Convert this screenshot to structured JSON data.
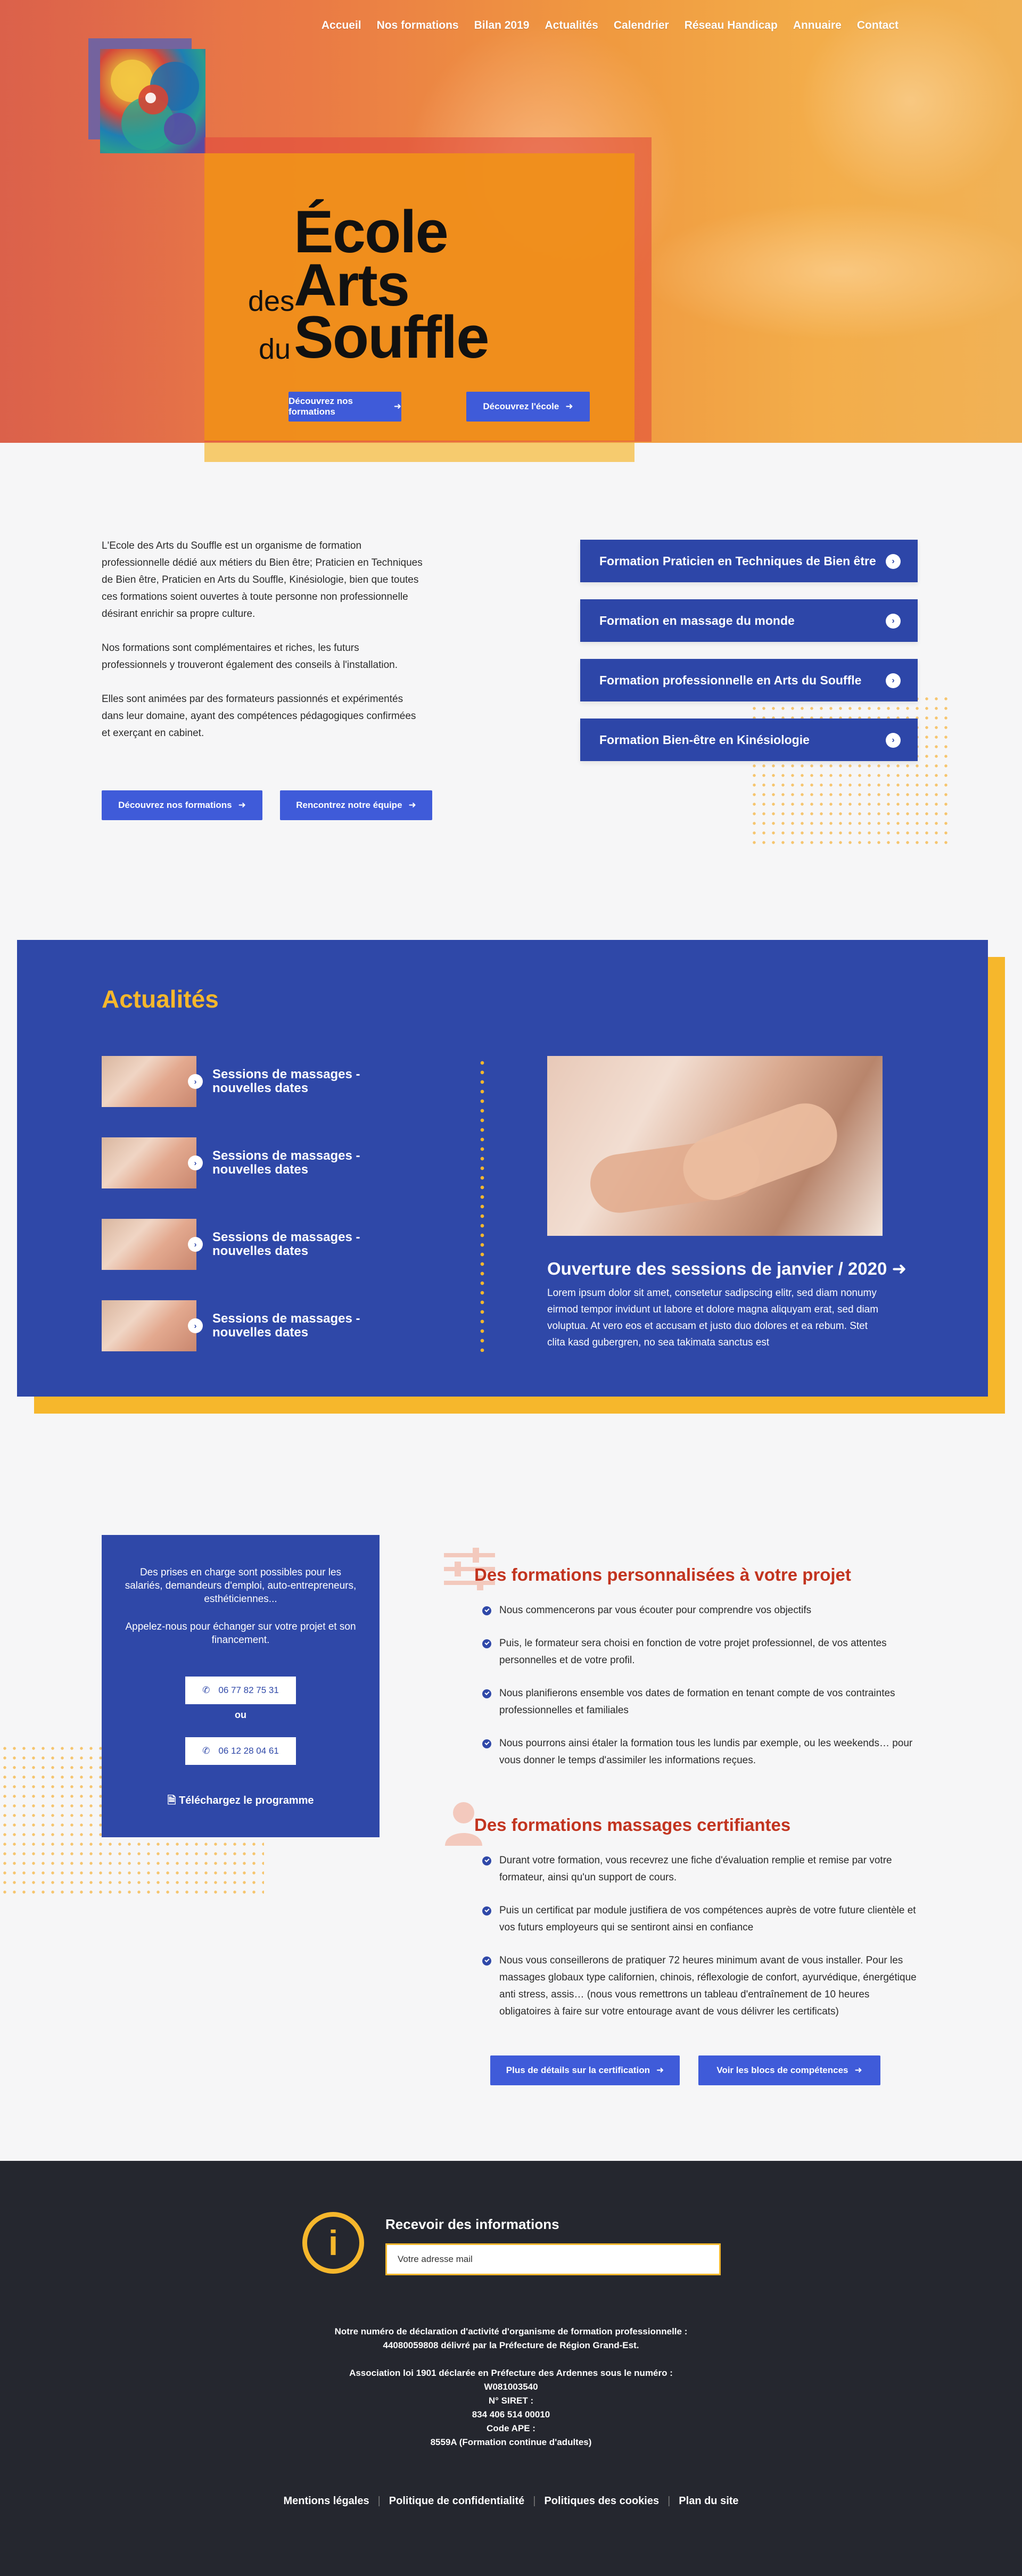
{
  "nav": [
    "Accueil",
    "Nos formations",
    "Bilan 2019",
    "Actualités",
    "Calendrier",
    "Réseau Handicap",
    "Annuaire",
    "Contact"
  ],
  "hero": {
    "title_ecole": "École",
    "title_des": "des",
    "title_arts": "Arts",
    "title_du": "du",
    "title_souffle": "Souffle",
    "btn_formations": "Découvrez nos formations",
    "btn_ecole": "Découvrez l'école"
  },
  "intro": {
    "p1": "L'Ecole des Arts du Souffle est un organisme de formation professionnelle dédié aux métiers du Bien être; Praticien en Techniques de Bien être, Praticien en Arts du Souffle, Kinésiologie, bien que toutes ces formations soient ouvertes à toute personne non professionnelle désirant enrichir sa propre culture.",
    "p2": "Nos formations sont complémentaires et riches, les futurs professionnels y trouveront également des conseils à l'installation.",
    "p3": "Elles sont animées par des formateurs passionnés et expérimentés dans leur domaine, ayant des compétences pédagogiques confirmées et exerçant en cabinet.",
    "btn_formations": "Découvrez nos formations",
    "btn_equipe": "Rencontrez notre équipe"
  },
  "formations": [
    "Formation Praticien en Techniques de Bien être",
    "Formation en massage du monde",
    "Formation professionnelle en Arts du Souffle",
    "Formation Bien-être en Kinésiologie"
  ],
  "news": {
    "title": "Actualités",
    "items": [
      "Sessions de massages - nouvelles dates",
      "Sessions de massages - nouvelles dates",
      "Sessions de massages - nouvelles dates",
      "Sessions de massages - nouvelles dates"
    ],
    "feature_title": "Ouverture des sessions de janvier / 2020",
    "feature_text": "Lorem ipsum dolor sit amet, consetetur sadipscing elitr, sed diam nonumy eirmod tempor invidunt ut labore et dolore magna aliquyam erat, sed diam voluptua. At vero eos et accusam et justo duo dolores et ea rebum. Stet clita kasd gubergren, no sea takimata sanctus est"
  },
  "contact": {
    "p1": "Des prises en charge sont possibles pour les salariés, demandeurs d'emploi, auto-entrepreneurs, esthéticiennes...",
    "p2": "Appelez-nous pour échanger sur votre projet et son financement.",
    "phone1": "06 77 82 75 31",
    "or": "ou",
    "phone2": "06 12 28 04 61",
    "download": "Téléchargez le programme"
  },
  "perso": {
    "title": "Des formations personnalisées à votre projet",
    "bullets": [
      "Nous commencerons par vous écouter pour comprendre vos objectifs",
      "Puis, le formateur sera choisi en fonction de votre projet professionnel,  de vos attentes personnelles et de votre profil.",
      "Nous planifierons ensemble vos dates de formation en tenant compte de vos contraintes professionnelles et familiales",
      "Nous pourrons ainsi étaler la formation tous les lundis par exemple, ou les weekends… pour vous donner le temps d'assimiler les informations reçues."
    ]
  },
  "certif": {
    "title": "Des formations massages certifiantes",
    "bullets": [
      "Durant votre formation, vous recevrez une fiche d'évaluation remplie et remise par votre formateur, ainsi qu'un support de cours.",
      "Puis un certificat par module justifiera de vos compétences auprès de votre future clientèle et vos futurs employeurs qui se sentiront ainsi en confiance",
      "Nous vous conseillerons de pratiquer 72 heures minimum avant de vous installer. Pour les massages globaux type californien, chinois, réflexologie de confort, ayurvédique, énergétique anti stress, assis… (nous vous remettrons un tableau d'entraînement de 10 heures obligatoires à faire sur votre entourage avant de vous délivrer les certificats)"
    ],
    "btn_details": "Plus de détails sur la certification",
    "btn_blocs": "Voir les blocs de compétences"
  },
  "footer": {
    "info_icon": "i",
    "receive": "Recevoir des informations",
    "email_placeholder": "Votre adresse mail",
    "legal1": "Notre numéro de déclaration d'activité d'organisme de formation professionnelle :",
    "legal2": "44080059808 délivré par la Préfecture de Région Grand-Est.",
    "legal3": "Association loi 1901 déclarée en Préfecture des Ardennes sous le numéro :",
    "legal4": "W081003540",
    "legal5": "N° SIRET :",
    "legal6": "834 406 514 00010",
    "legal7": "Code APE :",
    "legal8": "8559A  (Formation continue d'adultes)",
    "links": [
      "Mentions légales",
      "Politique de confidentialité",
      "Politiques des cookies",
      "Plan du site"
    ]
  },
  "colors": {
    "blue": "#2f48a8",
    "button_blue": "#3f5bd9",
    "yellow": "#f6b72c",
    "orange": "#f0901a",
    "red_title": "#c2341f",
    "footer_bg": "#25272f"
  },
  "icons": [
    "arrow-right-icon",
    "chevron-circle-icon",
    "phone-icon",
    "document-icon",
    "info-icon",
    "sliders-icon",
    "user-icon"
  ]
}
